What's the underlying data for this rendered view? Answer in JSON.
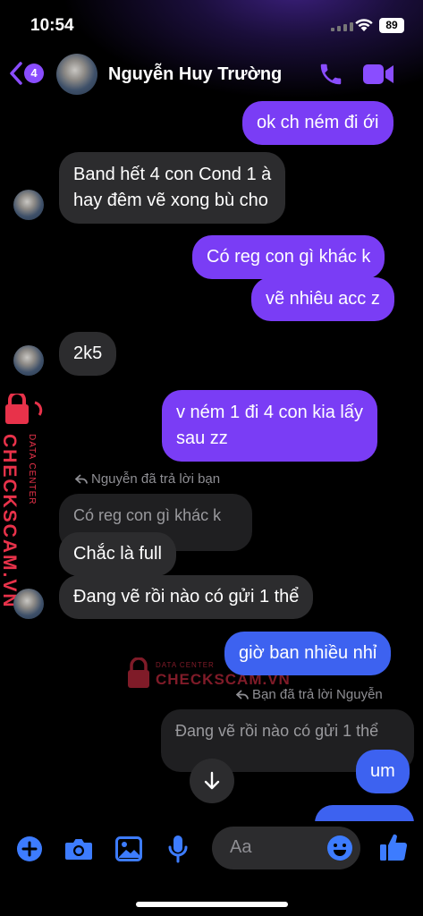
{
  "status": {
    "time": "10:54",
    "battery": "89"
  },
  "header": {
    "back_count": "4",
    "contact_name": "Nguyễn Huy Trường"
  },
  "messages": {
    "m1": "ok ch ném đi ới",
    "m2_line1": "Band hết 4 con Cond 1 à",
    "m2_line2": "hay đêm vẽ xong bù cho",
    "m3": "Có reg con gì khác k",
    "m4": "vẽ nhiêu acc z",
    "m5": "2k5",
    "m6_line1": "v ném 1 đi 4 con kia lấy",
    "m6_line2": "sau zz",
    "reply1_note": "Nguyễn đã trả lời bạn",
    "reply1_quote": "Có reg con gì khác k",
    "m7": "Chắc là full",
    "m8": "Đang vẽ rồi nào có gửi 1 thể",
    "m9": "giờ ban nhiều nhỉ",
    "reply2_note": "Bạn đã trả lời Nguyễn",
    "reply2_quote": "Đang vẽ rồi nào có gửi 1 thể",
    "m10": "um"
  },
  "watermark": {
    "brand": "CHECKSCAM.VN",
    "sub": "DATA CENTER"
  },
  "composer": {
    "placeholder": "Aa"
  },
  "icons": [
    "add-icon",
    "camera-icon",
    "gallery-icon",
    "microphone-icon",
    "emoji-icon",
    "like-icon",
    "phone-icon",
    "video-icon",
    "back-chevron-icon",
    "arrow-down-icon"
  ],
  "colors": {
    "accent": "#7a3df5",
    "outgoing_purple": "#7a3df5",
    "outgoing_blue": "#3d62f0",
    "incoming": "#2c2c2e",
    "icon_blue": "#3d7cff"
  }
}
